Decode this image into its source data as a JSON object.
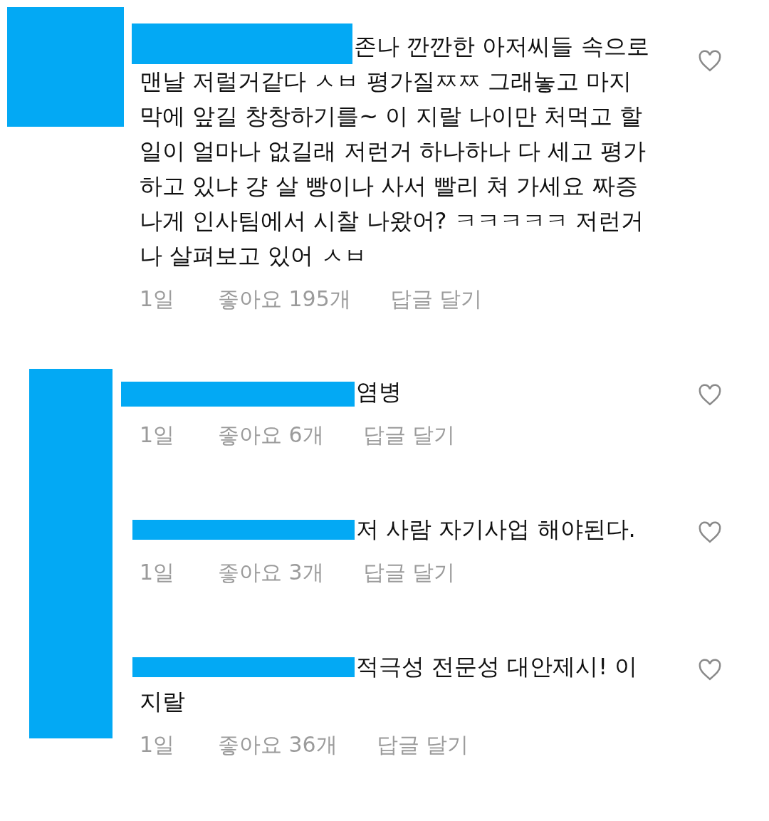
{
  "comment": {
    "text": "존나 깐깐한 아저씨들 속으로 맨날 저럴거같다 ㅅㅂ 평가질ㅉㅉ 그래놓고 마지막에 앞길 창창하기를~ 이 지랄 나이만 처먹고 할 일이 얼마나 없길래 저런거 하나하나 다 세고 평가하고 있냐 걍 살 빵이나 사서 빨리 쳐 가세요 짜증나게 인사팀에서 시찰 나왔어? ㅋㅋㅋㅋㅋ 저런거나 살펴보고 있어 ㅅㅂ",
    "time": "1일",
    "likes": "좋아요 195개",
    "reply": "답글 달기",
    "liked": false
  },
  "replies": [
    {
      "text": "염병",
      "time": "1일",
      "likes": "좋아요 6개",
      "reply": "답글 달기",
      "liked": false
    },
    {
      "text": "저 사람 자기사업 해야된다.",
      "time": "1일",
      "likes": "좋아요 3개",
      "reply": "답글 달기",
      "liked": false
    },
    {
      "text": "적극성 전문성 대안제시! 이지랄",
      "time": "1일",
      "likes": "좋아요 36개",
      "reply": "답글 달기",
      "liked": false
    }
  ]
}
